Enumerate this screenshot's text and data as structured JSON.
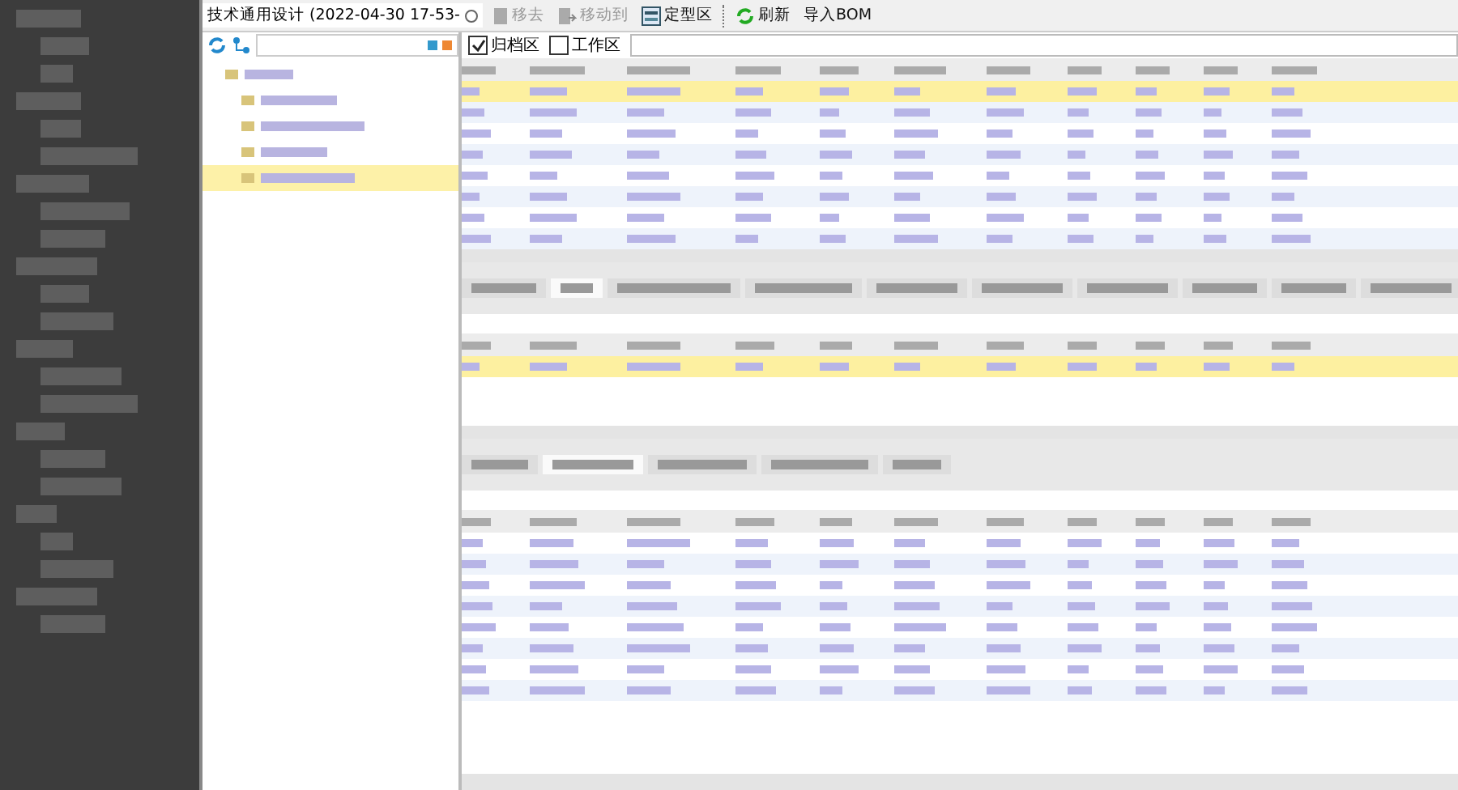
{
  "toolbar": {
    "document_tab": "技术通用设计 (2022-04-30  17-53-",
    "buttons": [
      {
        "kind": "remove",
        "label": "移去",
        "disabled": true
      },
      {
        "kind": "move",
        "label": "移动到",
        "disabled": true
      },
      {
        "kind": "area",
        "label": "定型区",
        "disabled": false
      },
      {
        "kind": "refresh",
        "label": "刷新",
        "disabled": false
      },
      {
        "kind": "import",
        "label": "导入BOM",
        "disabled": false
      }
    ]
  },
  "filters": [
    {
      "label": "归档区",
      "checked": true
    },
    {
      "label": "工作区",
      "checked": false
    }
  ],
  "tree": {
    "items": [
      {
        "selected": false
      },
      {
        "selected": false
      },
      {
        "selected": false
      },
      {
        "selected": false
      },
      {
        "selected": true
      }
    ]
  },
  "top_grid": {
    "rows": [
      {
        "selected": true
      },
      {
        "selected": false
      },
      {
        "selected": false
      },
      {
        "selected": false
      },
      {
        "selected": false
      },
      {
        "selected": false
      },
      {
        "selected": false
      },
      {
        "selected": false
      }
    ]
  },
  "middle_grid": {
    "rows": [
      {
        "selected": true
      }
    ]
  },
  "top_tabs": [
    {
      "selected": false
    },
    {
      "selected": true
    },
    {
      "selected": false
    },
    {
      "selected": false
    },
    {
      "selected": false
    },
    {
      "selected": false
    },
    {
      "selected": false
    },
    {
      "selected": false
    },
    {
      "selected": false
    },
    {
      "selected": false
    }
  ],
  "bottom_tabs": [
    {
      "selected": false
    },
    {
      "selected": true
    },
    {
      "selected": false
    },
    {
      "selected": false
    },
    {
      "selected": false
    }
  ],
  "bottom_grid": {
    "rows": [
      {
        "selected": false
      },
      {
        "selected": false
      },
      {
        "selected": false
      },
      {
        "selected": false
      },
      {
        "selected": false
      },
      {
        "selected": false
      },
      {
        "selected": false
      },
      {
        "selected": false
      }
    ]
  }
}
